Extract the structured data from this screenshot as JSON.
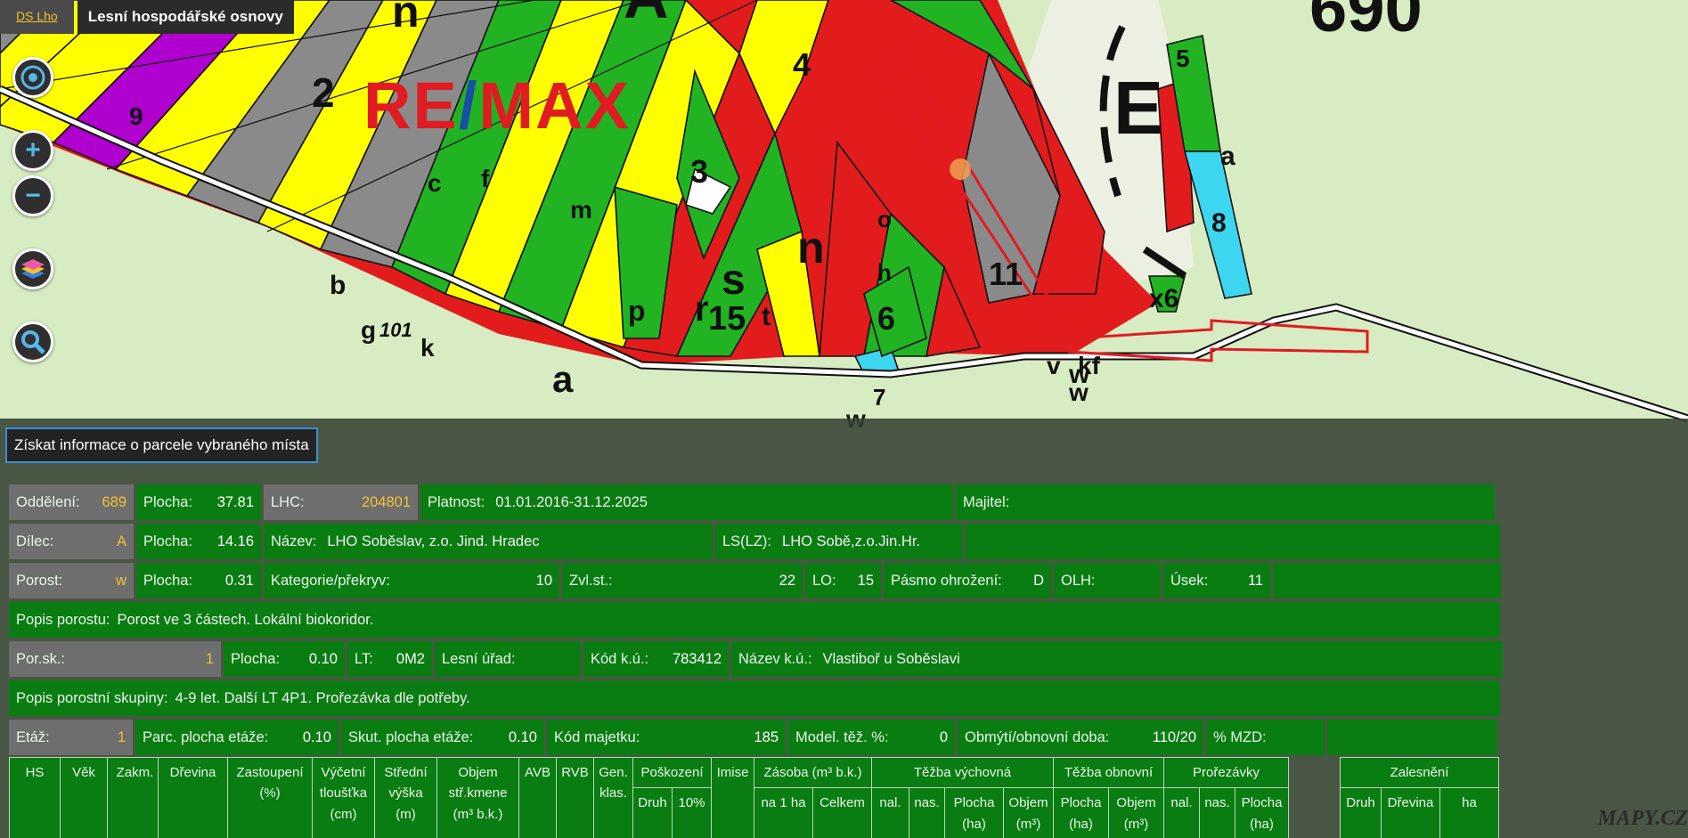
{
  "tabs": {
    "link": "DS Lho",
    "title": "Lesní hospodářské osnovy"
  },
  "watermark": {
    "re": "RE",
    "slash": "/",
    "max": "MAX"
  },
  "map": {
    "big_number": "690",
    "labels": [
      "n",
      "A",
      "E",
      "b",
      "a",
      "g",
      "k",
      "n",
      "s",
      "r",
      "p",
      "w",
      "v",
      "kf",
      "t",
      "o",
      "h",
      "f",
      "c",
      "m",
      "x6",
      "7",
      "6",
      "5",
      "4",
      "3",
      "2",
      "1",
      "8",
      "9",
      "11",
      "15",
      "101",
      "0",
      "g",
      "k",
      "b",
      "a",
      "w",
      "v",
      "w"
    ]
  },
  "controls": {
    "locate": "locate-icon",
    "zoom_in": "+",
    "zoom_out": "−",
    "layers": "layers-icon",
    "search": "search-icon"
  },
  "info_button": "Získat informace o parcele vybraného místa",
  "rows": {
    "r1": {
      "oddeleni_lbl": "Oddělení:",
      "oddeleni_val": "689",
      "plocha_lbl": "Plocha:",
      "plocha_val": "37.81",
      "lhc_lbl": "LHC:",
      "lhc_val": "204801",
      "platnost_lbl": "Platnost:",
      "platnost_val": "01.01.2016-31.12.2025",
      "majitel_lbl": "Majitel:"
    },
    "r2": {
      "dilec_lbl": "Dílec:",
      "dilec_val": "A",
      "plocha_lbl": "Plocha:",
      "plocha_val": "14.16",
      "nazev_lbl": "Název:",
      "nazev_val": "LHO Soběslav, z.o. Jind. Hradec",
      "ls_lbl": "LS(LZ):",
      "ls_val": "LHO Sobě,z.o.Jin.Hr."
    },
    "r3": {
      "porost_lbl": "Porost:",
      "porost_val": "w",
      "plocha_lbl": "Plocha:",
      "plocha_val": "0.31",
      "kat_lbl": "Kategorie/překryv:",
      "kat_val": "10",
      "zvl_lbl": "Zvl.st.:",
      "zvl_val": "22",
      "lo_lbl": "LO:",
      "lo_val": "15",
      "pasmo_lbl": "Pásmo ohrožení:",
      "pasmo_val": "D",
      "olh_lbl": "OLH:",
      "usek_lbl": "Úsek:",
      "usek_val": "11"
    },
    "r4": {
      "popis_lbl": "Popis porostu:",
      "popis_val": "Porost ve 3 částech. Lokální biokoridor."
    },
    "r5": {
      "porsk_lbl": "Por.sk.:",
      "porsk_val": "1",
      "plocha_lbl": "Plocha:",
      "plocha_val": "0.10",
      "lt_lbl": "LT:",
      "lt_val": "0M2",
      "urad_lbl": "Lesní úřad:",
      "kod_lbl": "Kód k.ú.:",
      "kod_val": "783412",
      "nazku_lbl": "Název k.ú.:",
      "nazku_val": "Vlastiboř u Soběslavi"
    },
    "r6": {
      "popis_lbl": "Popis porostní skupiny:",
      "popis_val": "4-9 let. Další LT 4P1. Prořezávka dle potřeby."
    },
    "r7": {
      "etaz_lbl": "Etáž:",
      "etaz_val": "1",
      "parc_lbl": "Parc. plocha etáže:",
      "parc_val": "0.10",
      "skut_lbl": "Skut. plocha etáže:",
      "skut_val": "0.10",
      "kodmaj_lbl": "Kód majetku:",
      "kodmaj_val": "185",
      "model_lbl": "Model. těž. %:",
      "model_val": "0",
      "obmyti_lbl": "Obmýtí/obnovní doba:",
      "obmyti_val": "110/20",
      "mzd_lbl": "% MZD:"
    }
  },
  "table": {
    "t1": [
      "HS",
      "Věk",
      "Zakm."
    ],
    "t2": {
      "drevina": "Dřevina",
      "zastoupeni": "Zastoupení (%)",
      "vycetni": "Výčetní tloušťka (cm)",
      "stredni": "Střední výška (m)",
      "objem": "Objem stř.kmene (m³ b.k.)",
      "avb": "AVB",
      "rvb": "RVB",
      "gen": "Gen. klas.",
      "poskozeni": "Poškození",
      "druh": "Druh",
      "pct": "10%",
      "imise": "Imise",
      "zasoba": "Zásoba (m³ b.k.)",
      "na1ha": "na 1 ha",
      "celkem": "Celkem",
      "tv": "Těžba výchovná",
      "nal": "nal.",
      "nas": "nas.",
      "plocha": "Plocha (ha)",
      "objemm3": "Objem (m³)",
      "to": "Těžba obnovní",
      "prorezavky": "Prořezávky"
    },
    "t3": {
      "zalesneni": "Zalesnění",
      "druh": "Druh",
      "drevina": "Dřevina",
      "ha": "ha"
    }
  },
  "mapy_logo": "MAPY.CZ"
}
